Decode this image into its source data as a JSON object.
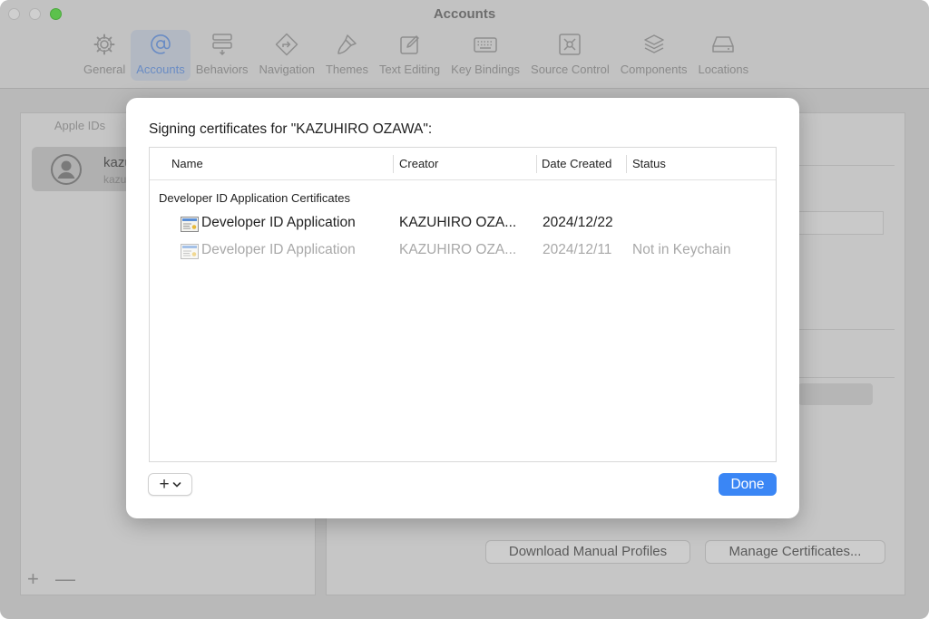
{
  "window": {
    "title": "Accounts"
  },
  "toolbar": {
    "items": [
      {
        "label": "General",
        "icon": "gear-icon"
      },
      {
        "label": "Accounts",
        "icon": "at-icon"
      },
      {
        "label": "Behaviors",
        "icon": "behaviors-icon"
      },
      {
        "label": "Navigation",
        "icon": "navigation-icon"
      },
      {
        "label": "Themes",
        "icon": "brush-icon"
      },
      {
        "label": "Text Editing",
        "icon": "pencil-square-icon"
      },
      {
        "label": "Key Bindings",
        "icon": "keyboard-icon"
      },
      {
        "label": "Source Control",
        "icon": "source-control-icon"
      },
      {
        "label": "Components",
        "icon": "stack-icon"
      },
      {
        "label": "Locations",
        "icon": "drive-icon"
      }
    ],
    "active_index": 1
  },
  "sidebar": {
    "header": "Apple IDs",
    "account": {
      "name": "kazul",
      "subtitle": "kazuh",
      "icon": "user-avatar-icon"
    },
    "add_label": "+",
    "remove_label": "—"
  },
  "detail": {
    "download_button": "Download Manual Profiles",
    "manage_button": "Manage Certificates..."
  },
  "dialog": {
    "title": "Signing certificates for \"KAZUHIRO OZAWA\":",
    "columns": {
      "name": "Name",
      "creator": "Creator",
      "date": "Date Created",
      "status": "Status"
    },
    "group_label": "Developer ID Application Certificates",
    "rows": [
      {
        "name": "Developer ID Application",
        "creator": "KAZUHIRO OZA...",
        "date": "2024/12/22",
        "status": "",
        "icon": "certificate-icon"
      },
      {
        "name": "Developer ID Application",
        "creator": "KAZUHIRO OZA...",
        "date": "2024/12/11",
        "status": "Not in Keychain",
        "icon": "certificate-icon"
      }
    ],
    "add_menu_label": "+",
    "done_label": "Done"
  },
  "colors": {
    "accent": "#3a86f5",
    "traffic_green": "#5cc14c"
  }
}
